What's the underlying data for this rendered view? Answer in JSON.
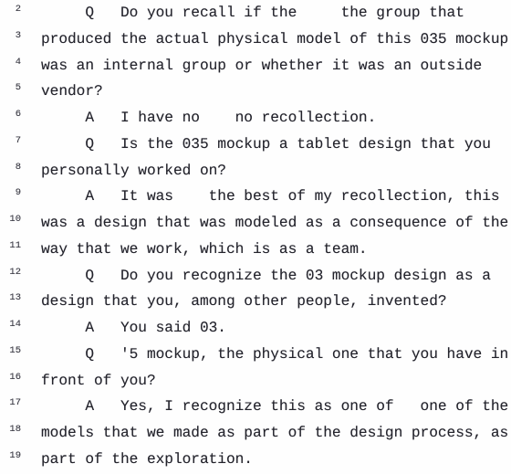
{
  "document": {
    "type": "deposition-transcript",
    "page_background": "#fefefe",
    "text_color": "#23232b",
    "line_number_color": "#3b3b44",
    "first_line_number": 2,
    "last_line_number": 19
  },
  "lines": [
    {
      "number": "2",
      "text": "     Q   Do you recall if the     the group that"
    },
    {
      "number": "3",
      "text": "produced the actual physical model of this 035 mockup"
    },
    {
      "number": "4",
      "text": "was an internal group or whether it was an outside"
    },
    {
      "number": "5",
      "text": "vendor?"
    },
    {
      "number": "6",
      "text": "     A   I have no    no recollection."
    },
    {
      "number": "7",
      "text": "     Q   Is the 035 mockup a tablet design that you"
    },
    {
      "number": "8",
      "text": "personally worked on?"
    },
    {
      "number": "9",
      "text": "     A   It was    the best of my recollection, this"
    },
    {
      "number": "10",
      "text": "was a design that was modeled as a consequence of the"
    },
    {
      "number": "11",
      "text": "way that we work, which is as a team."
    },
    {
      "number": "12",
      "text": "     Q   Do you recognize the 03 mockup design as a"
    },
    {
      "number": "13",
      "text": "design that you, among other people, invented?"
    },
    {
      "number": "14",
      "text": "     A   You said 03."
    },
    {
      "number": "15",
      "text": "     Q   '5 mockup, the physical one that you have in"
    },
    {
      "number": "16",
      "text": "front of you?"
    },
    {
      "number": "17",
      "text": "     A   Yes, I recognize this as one of   one of the"
    },
    {
      "number": "18",
      "text": "models that we made as part of the design process, as"
    },
    {
      "number": "19",
      "text": "part of the exploration."
    }
  ]
}
